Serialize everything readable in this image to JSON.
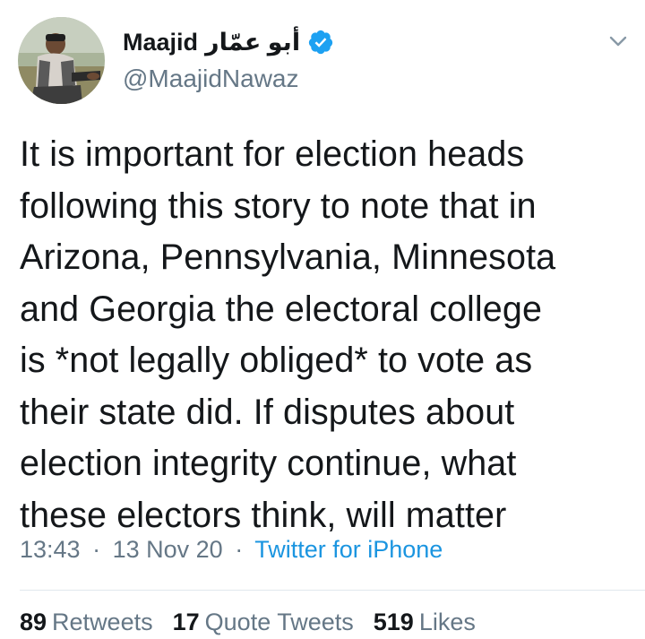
{
  "author": {
    "display_name": "Maajid",
    "arabic_name": "أبو عمّار",
    "handle": "@MaajidNawaz",
    "verified": true,
    "avatar_icon": "avatar-photo"
  },
  "tweet": {
    "lines": [
      "It is important for election heads",
      "following this story to note that in",
      "Arizona, Pennsylvania, Minnesota",
      "and Georgia the electoral college",
      "is *not legally obliged* to vote as",
      "their state did. If disputes about",
      "election integrity continue, what",
      "these electors think, will matter"
    ]
  },
  "meta": {
    "time": "13:43",
    "date": "13 Nov 20",
    "separator": "·",
    "source": "Twitter for iPhone"
  },
  "stats": {
    "retweets_count": "89",
    "retweets_label": "Retweets",
    "quotes_count": "17",
    "quotes_label": "Quote Tweets",
    "likes_count": "519",
    "likes_label": "Likes"
  },
  "colors": {
    "text": "#14171a",
    "secondary": "#657786",
    "link": "#1b95e0",
    "verified": "#1da1f2",
    "divider": "#e1e8ed"
  },
  "icons": {
    "verified": "verified-badge-icon",
    "menu": "chevron-down-icon"
  }
}
